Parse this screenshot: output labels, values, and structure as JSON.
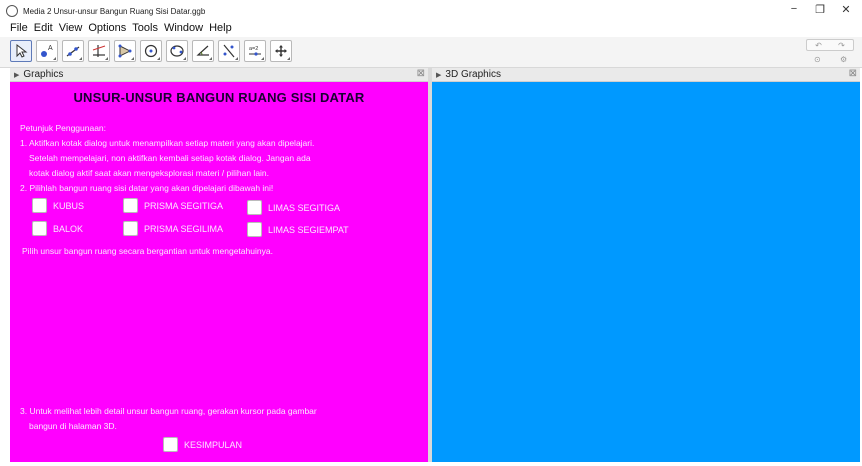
{
  "window": {
    "title": "Media 2 Unsur-unsur Bangun Ruang Sisi Datar.ggb",
    "controls": {
      "minimize": "−",
      "maximize": "❐",
      "close": "✕"
    }
  },
  "menu": [
    "File",
    "Edit",
    "View",
    "Options",
    "Tools",
    "Window",
    "Help"
  ],
  "toolbar": {
    "tools": [
      {
        "name": "move-tool",
        "icon": "arrow-cursor-icon"
      },
      {
        "name": "point-tool",
        "icon": "point-icon"
      },
      {
        "name": "line-tool",
        "icon": "line-icon"
      },
      {
        "name": "perpendicular-tool",
        "icon": "perpendicular-icon"
      },
      {
        "name": "polygon-tool",
        "icon": "polygon-icon"
      },
      {
        "name": "circle-tool",
        "icon": "circle-icon"
      },
      {
        "name": "circle-three-points-tool",
        "icon": "circle-points-icon"
      },
      {
        "name": "angle-tool",
        "icon": "angle-icon"
      },
      {
        "name": "reflect-tool",
        "icon": "reflect-icon"
      },
      {
        "name": "slider-tool",
        "icon": "slider-icon"
      },
      {
        "name": "move-view-tool",
        "icon": "move-view-icon"
      }
    ],
    "slider_label": "a=2",
    "undo": "↶",
    "redo": "↷"
  },
  "panels": {
    "graphics_title": "Graphics",
    "view3d_title": "3D Graphics",
    "close_glyph": "⊠"
  },
  "content": {
    "heading": "UNSUR-UNSUR BANGUN RUANG SISI DATAR",
    "instructions_title": "Petunjuk Penggunaan:",
    "line1": "1. Aktifkan kotak dialog untuk menampilkan setiap materi yang akan dipelajari.",
    "line2": "Setelah mempelajari, non aktifkan kembali setiap kotak dialog. Jangan ada",
    "line3": "kotak dialog aktif saat akan mengeksplorasi materi / pilihan lain.",
    "line4": "2. Pilihlah bangun ruang sisi datar yang akan dipelajari dibawah ini!",
    "line5": "Pilih unsur bangun ruang secara bergantian untuk mengetahuinya.",
    "line6": "3. Untuk melihat lebih detail unsur bangun ruang, gerakan kursor pada gambar",
    "line7": "bangun di halaman 3D.",
    "checkboxes": {
      "kubus": "KUBUS",
      "balok": "BALOK",
      "prisma_segitiga": "PRISMA SEGITIGA",
      "prisma_segilima": "PRISMA SEGILIMA",
      "limas_segitiga": "LIMAS SEGITIGA",
      "limas_segiempat": "LIMAS SEGIEMPAT",
      "kesimpulan": "KESIMPULAN"
    }
  },
  "colors": {
    "graphics_bg": "#ff00ff",
    "view3d_bg": "#0099ff",
    "heading_text": "#1a0033"
  }
}
